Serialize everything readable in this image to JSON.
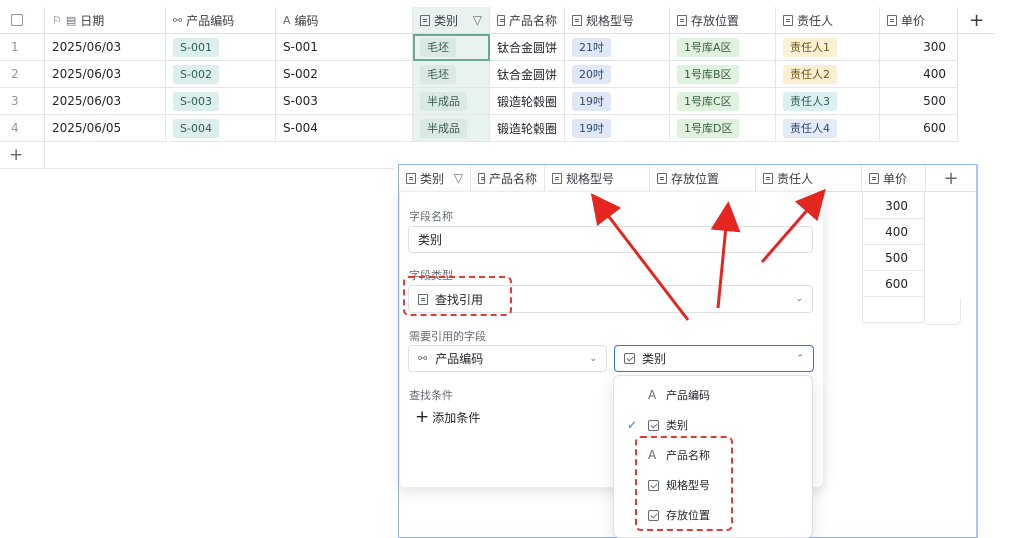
{
  "header": {
    "date": "日期",
    "code": "产品编码",
    "code2": "编码",
    "category": "类别",
    "name": "产品名称",
    "spec": "规格型号",
    "location": "存放位置",
    "owner": "责任人",
    "price": "单价",
    "add": "+"
  },
  "rows": [
    {
      "idx": "1",
      "date": "2025/06/03",
      "code": "S-001",
      "code2": "S-001",
      "category": "毛坯",
      "name": "钛合金圆饼",
      "spec": "21吋",
      "location": "1号库A区",
      "owner": "责任人1",
      "price": "300"
    },
    {
      "idx": "2",
      "date": "2025/06/03",
      "code": "S-002",
      "code2": "S-002",
      "category": "毛坯",
      "name": "钛合金圆饼",
      "spec": "20吋",
      "location": "1号库B区",
      "owner": "责任人2",
      "price": "400"
    },
    {
      "idx": "3",
      "date": "2025/06/03",
      "code": "S-003",
      "code2": "S-003",
      "category": "半成品",
      "name": "锻造轮毂圈",
      "spec": "19吋",
      "location": "1号库C区",
      "owner": "责任人3",
      "price": "500"
    },
    {
      "idx": "4",
      "date": "2025/06/05",
      "code": "S-004",
      "code2": "S-004",
      "category": "半成品",
      "name": "锻造轮毂圈",
      "spec": "19吋",
      "location": "1号库D区",
      "owner": "责任人4",
      "price": "600"
    }
  ],
  "add_row": "+",
  "overlay_header": {
    "category": "类别",
    "name": "产品名称",
    "spec": "规格型号",
    "location": "存放位置",
    "owner": "责任人",
    "price": "单价",
    "add": "+"
  },
  "overlay_prices": [
    "300",
    "400",
    "500",
    "600"
  ],
  "panel": {
    "field_name_label": "字段名称",
    "field_name_value": "类别",
    "field_type_label": "字段类型",
    "field_type_value": "查找引用",
    "ref_label": "需要引用的字段",
    "ref_left": "产品编码",
    "ref_right": "类别",
    "cond_label": "查找条件",
    "add_condition": "添加条件"
  },
  "dropdown": {
    "options": [
      {
        "label": "产品编码",
        "icon": "text-icon",
        "checked": false
      },
      {
        "label": "类别",
        "icon": "select-icon",
        "checked": true
      },
      {
        "label": "产品名称",
        "icon": "text-icon",
        "checked": false
      },
      {
        "label": "规格型号",
        "icon": "select-icon",
        "checked": false
      },
      {
        "label": "存放位置",
        "icon": "select-icon",
        "checked": false
      }
    ]
  },
  "colors": {
    "accent": "#3370ff",
    "highlight_red": "#e53935",
    "category_column": "#e8f3ef"
  }
}
